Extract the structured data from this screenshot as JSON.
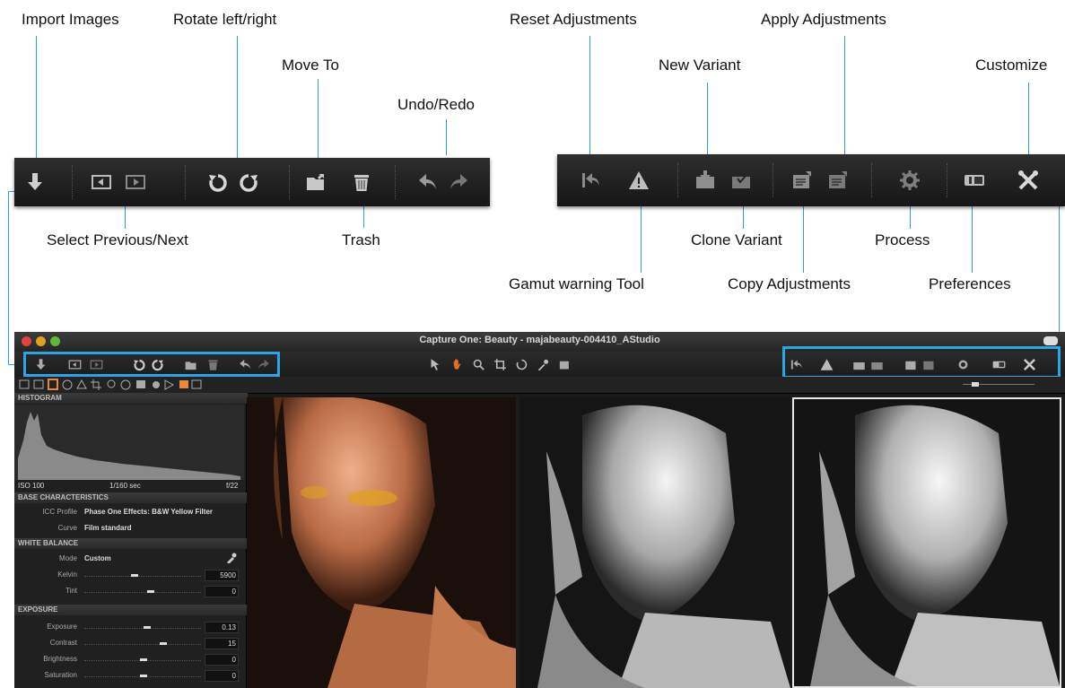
{
  "callouts": {
    "import_images": "Import Images",
    "rotate": "Rotate left/right",
    "move_to": "Move To",
    "undo_redo": "Undo/Redo",
    "select_prev_next": "Select Previous/Next",
    "trash": "Trash",
    "reset_adjustments": "Reset Adjustments",
    "new_variant": "New Variant",
    "apply_adjustments": "Apply Adjustments",
    "customize": "Customize",
    "clone_variant": "Clone Variant",
    "process": "Process",
    "gamut_warning": "Gamut warning Tool",
    "copy_adjustments": "Copy Adjustments",
    "preferences": "Preferences"
  },
  "window": {
    "title": "Capture One: Beauty - majabeauty-004410_AStudio"
  },
  "panel": {
    "histogram": {
      "header": "HISTOGRAM",
      "iso": "ISO 100",
      "shutter": "1/160 sec",
      "aperture": "f/22"
    },
    "base": {
      "header": "BASE CHARACTERISTICS",
      "icc_label": "ICC Profile",
      "icc_value": "Phase One Effects: B&W Yellow Filter",
      "curve_label": "Curve",
      "curve_value": "Film standard"
    },
    "white_balance": {
      "header": "WHITE BALANCE",
      "mode_label": "Mode",
      "mode_value": "Custom",
      "kelvin_label": "Kelvin",
      "kelvin_value": "5900",
      "tint_label": "Tint",
      "tint_value": "0"
    },
    "exposure": {
      "header": "EXPOSURE",
      "exposure_label": "Exposure",
      "exposure_value": "0.13",
      "contrast_label": "Contrast",
      "contrast_value": "15",
      "brightness_label": "Brightness",
      "brightness_value": "0",
      "saturation_label": "Saturation",
      "saturation_value": "0"
    }
  },
  "colors": {
    "highlight": "#2aa6e6",
    "leader": "#2a9fd6",
    "toolbar_bg": "#1e1e1e"
  }
}
